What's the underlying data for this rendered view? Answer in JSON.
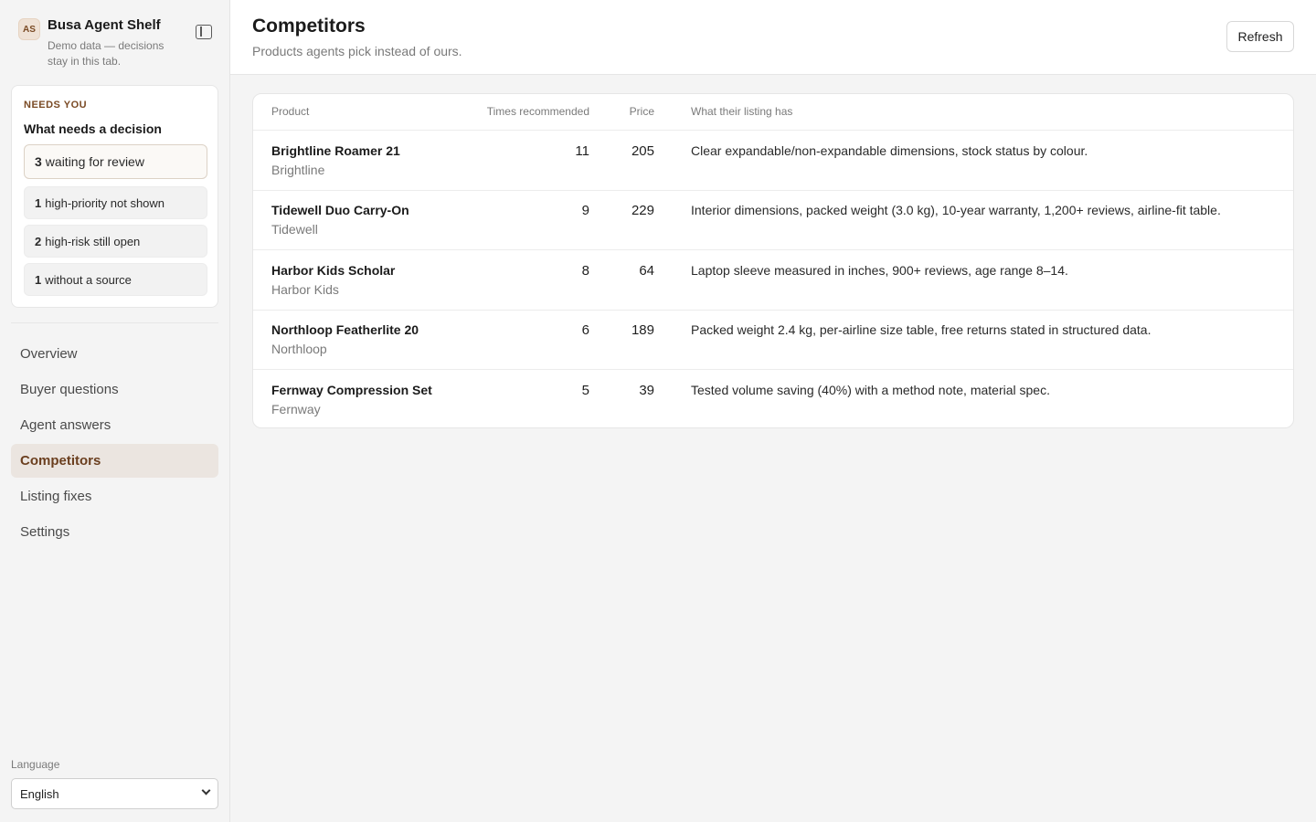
{
  "brand": {
    "avatar_initials": "AS",
    "title": "Busa Agent Shelf",
    "subtitle": "Demo data — decisions stay in this tab."
  },
  "needs": {
    "eyebrow": "NEEDS YOU",
    "title": "What needs a decision",
    "items": [
      {
        "count": "3",
        "label": "waiting for review"
      },
      {
        "count": "1",
        "label": "high-priority not shown"
      },
      {
        "count": "2",
        "label": "high-risk still open"
      },
      {
        "count": "1",
        "label": "without a source"
      }
    ]
  },
  "nav": {
    "items": [
      {
        "label": "Overview"
      },
      {
        "label": "Buyer questions"
      },
      {
        "label": "Agent answers"
      },
      {
        "label": "Competitors",
        "active": true
      },
      {
        "label": "Listing fixes"
      },
      {
        "label": "Settings"
      }
    ]
  },
  "language": {
    "label": "Language",
    "selected": "English"
  },
  "header": {
    "title": "Competitors",
    "subtitle": "Products agents pick instead of ours.",
    "refresh_label": "Refresh"
  },
  "table": {
    "columns": {
      "product": "Product",
      "times": "Times recommended",
      "price": "Price",
      "has": "What their listing has"
    },
    "rows": [
      {
        "name": "Brightline Roamer 21",
        "brand": "Brightline",
        "times": "11",
        "price": "205",
        "has": "Clear expandable/non-expandable dimensions, stock status by colour."
      },
      {
        "name": "Tidewell Duo Carry-On",
        "brand": "Tidewell",
        "times": "9",
        "price": "229",
        "has": "Interior dimensions, packed weight (3.0 kg), 10-year warranty, 1,200+ reviews, airline-fit table."
      },
      {
        "name": "Harbor Kids Scholar",
        "brand": "Harbor Kids",
        "times": "8",
        "price": "64",
        "has": "Laptop sleeve measured in inches, 900+ reviews, age range 8–14."
      },
      {
        "name": "Northloop Featherlite 20",
        "brand": "Northloop",
        "times": "6",
        "price": "189",
        "has": "Packed weight 2.4 kg, per-airline size table, free returns stated in structured data."
      },
      {
        "name": "Fernway Compression Set",
        "brand": "Fernway",
        "times": "5",
        "price": "39",
        "has": "Tested volume saving (40%) with a method note, material spec."
      }
    ]
  }
}
